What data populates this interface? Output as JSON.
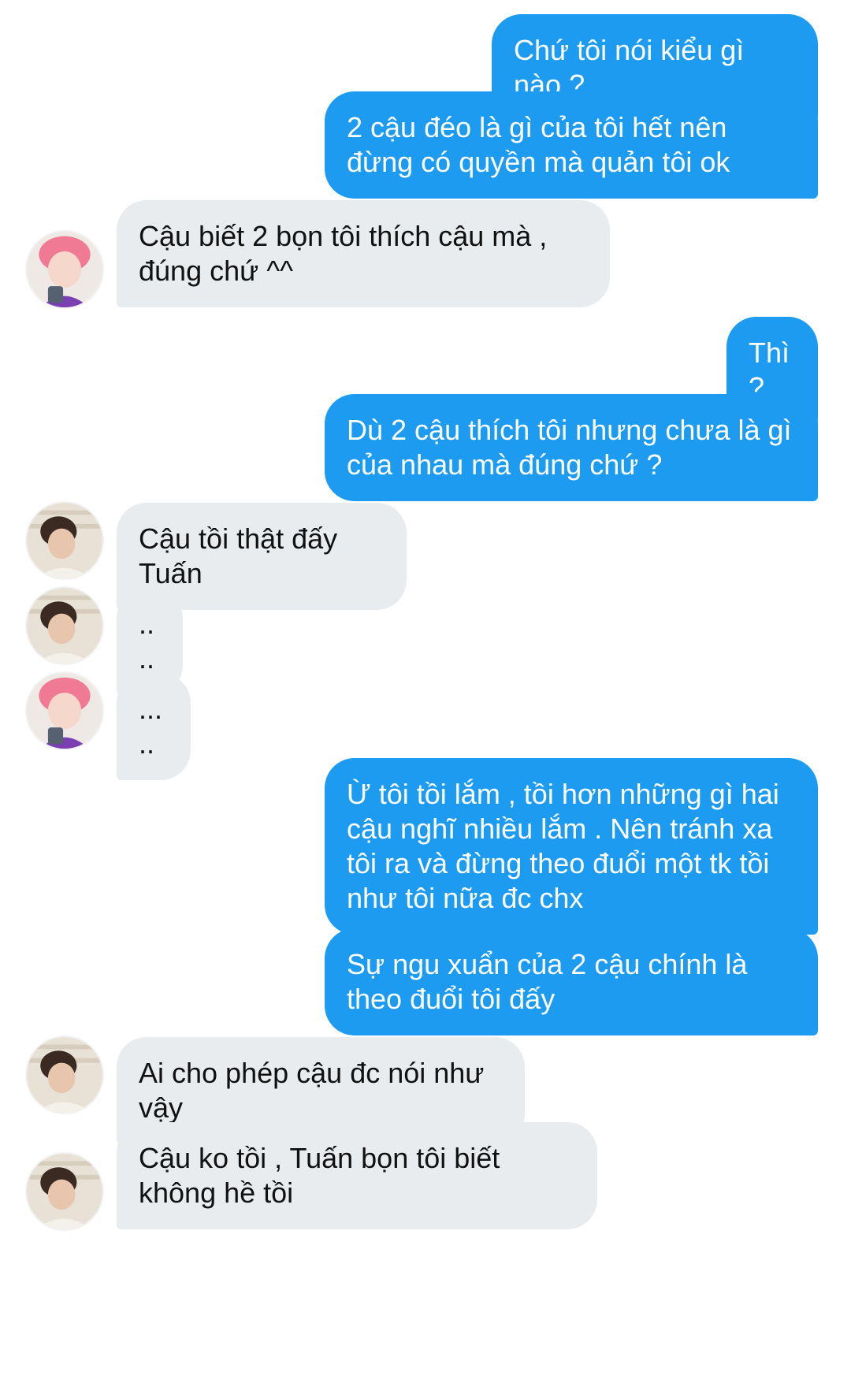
{
  "messages": [
    {
      "id": "m1",
      "from": "me",
      "text": "Chứ tôi nói kiểu gì nào ?"
    },
    {
      "id": "m2",
      "from": "me",
      "text": "2 cậu đéo là gì của tôi hết nên đừng có quyền mà quản tôi ok"
    },
    {
      "id": "m3",
      "from": "pink-hair",
      "text": "Cậu biết 2 bọn tôi thích cậu mà , đúng chứ ^^"
    },
    {
      "id": "m4",
      "from": "me",
      "text": "Thì?"
    },
    {
      "id": "m5",
      "from": "me",
      "text": "Dù 2 cậu thích tôi nhưng chưa là gì của nhau mà đúng chứ ?"
    },
    {
      "id": "m6",
      "from": "dark-hair",
      "text": "Cậu tồi thật đấy Tuấn"
    },
    {
      "id": "m7",
      "from": "dark-hair",
      "text": "...."
    },
    {
      "id": "m8",
      "from": "pink-hair",
      "text": "....."
    },
    {
      "id": "m9",
      "from": "me",
      "text": "Ừ tôi tồi lắm , tồi hơn những gì hai cậu nghĩ nhiều lắm . Nên tránh xa tôi ra và đừng theo đuổi một tk tồi như tôi nữa đc chx"
    },
    {
      "id": "m10",
      "from": "me",
      "text": "Sự ngu xuẩn của 2 cậu chính là theo đuổi tôi đấy"
    },
    {
      "id": "m11",
      "from": "dark-hair",
      "text": "Ai cho phép cậu đc nói như vậy"
    },
    {
      "id": "m12",
      "from": "dark-hair",
      "text": "Cậu ko tồi , Tuấn bọn tôi biết không hề tồi"
    }
  ],
  "colors": {
    "outgoing_bubble": "#1d9bf0",
    "incoming_bubble": "#e9ecef"
  }
}
